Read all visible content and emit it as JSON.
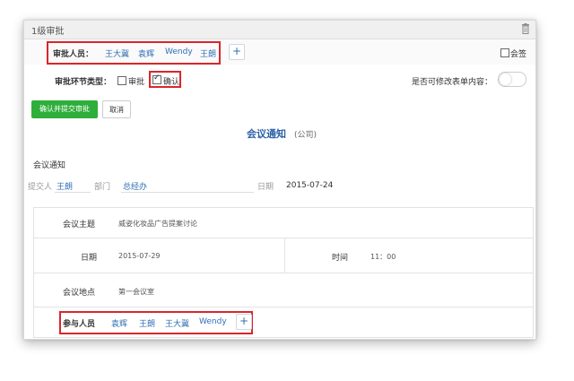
{
  "header": {
    "title": "1级审批"
  },
  "approver_row": {
    "label": "审批人员：",
    "persons": [
      "王大冀",
      "袁辉",
      "Wendy",
      "王朗"
    ],
    "add": "+",
    "countersign_label": "会签"
  },
  "type_row": {
    "label": "审批环节类型：",
    "option_approve": "审批",
    "option_confirm": "确认",
    "editable_label": "是否可修改表单内容："
  },
  "buttons": {
    "confirm_submit": "确认并提交审批",
    "cancel": "取消"
  },
  "form": {
    "title": "会议通知",
    "subtitle": "(公司)",
    "section_label": "会议通知",
    "submitter_label": "提交人",
    "submitter_value": "王朗",
    "dept_label": "部门",
    "dept_value": "总经办",
    "date_label": "日期",
    "date_value": "2015-07-24",
    "topic_label": "会议主题",
    "topic_value": "威姿化妆品广告提案讨论",
    "meeting_date_label": "日期",
    "meeting_date_value": "2015-07-29",
    "time_label": "时间",
    "time_value": "11：00",
    "location_label": "会议地点",
    "location_value": "第一会议室",
    "participants_label": "参与人员",
    "participants": [
      "袁辉",
      "王朗",
      "王大冀",
      "Wendy"
    ],
    "add": "+"
  },
  "colors": {
    "accent": "#2f6fb5",
    "green": "#2eae3a",
    "highlight": "#d9262c"
  }
}
